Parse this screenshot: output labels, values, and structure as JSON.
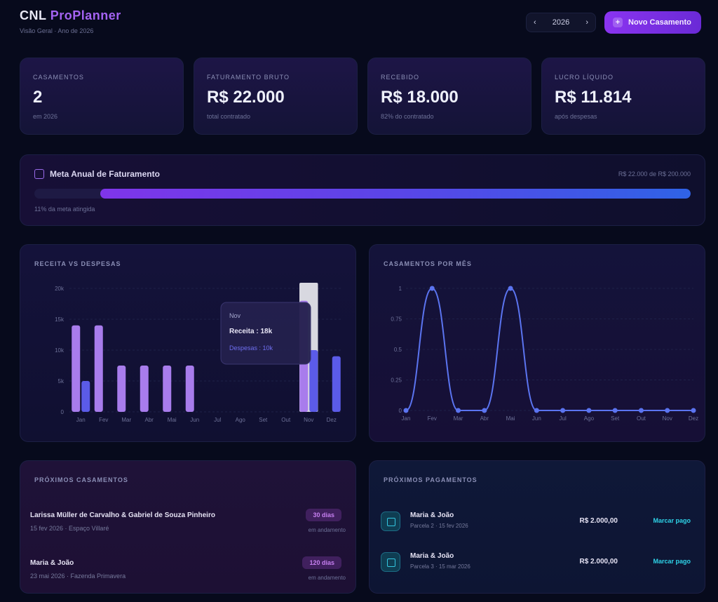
{
  "header": {
    "logo_part1": "CNL",
    "logo_part2": "ProPlanner",
    "subtitle": "Visão Geral · Ano de 2026",
    "year_value": "2026",
    "new_button_label": "Novo Casamento"
  },
  "stats": [
    {
      "label": "Casamentos",
      "value": "2",
      "sub": "em 2026"
    },
    {
      "label": "Faturamento Bruto",
      "value": "R$ 22.000",
      "sub": "total contratado"
    },
    {
      "label": "Recebido",
      "value": "R$ 18.000",
      "sub": "82% do contratado"
    },
    {
      "label": "Lucro Líquido",
      "value": "R$ 11.814",
      "sub": "após despesas"
    }
  ],
  "goal": {
    "title": "Meta Anual de Faturamento",
    "range": "R$ 22.000 de R$ 200.000",
    "note": "11% da meta atingida",
    "progress": 0.11
  },
  "revenue_chart": {
    "title": "Receita vs Despesas",
    "tooltip": {
      "month": "Nov",
      "receita_label": "Receita : 18k",
      "despesa_label": "Despesas : 10k"
    }
  },
  "weddings_chart": {
    "title": "Casamentos por Mês"
  },
  "chart_data": [
    {
      "type": "bar",
      "categories": [
        "Jan",
        "Fev",
        "Mar",
        "Abr",
        "Mai",
        "Jun",
        "Jul",
        "Ago",
        "Set",
        "Out",
        "Nov",
        "Dez"
      ],
      "series": [
        {
          "name": "Receita",
          "values": [
            14,
            14,
            7.5,
            7.5,
            7.5,
            7.5,
            0,
            0,
            0,
            0,
            18,
            0
          ]
        },
        {
          "name": "Despesas",
          "values": [
            5,
            0,
            0,
            0,
            0,
            0,
            0,
            0,
            0,
            0,
            10,
            9
          ]
        }
      ],
      "yticks": [
        "0",
        "5k",
        "10k",
        "15k",
        "20k"
      ],
      "ylim": [
        0,
        20
      ],
      "colors": {
        "Receita": "#a87cec",
        "Despesas": "#5b5be8"
      }
    },
    {
      "type": "line",
      "categories": [
        "Jan",
        "Fev",
        "Mar",
        "Abr",
        "Mai",
        "Jun",
        "Jul",
        "Ago",
        "Set",
        "Out",
        "Nov",
        "Dez"
      ],
      "series": [
        {
          "name": "Casamentos",
          "values": [
            0,
            1,
            0,
            0,
            1,
            0,
            0,
            0,
            0,
            0,
            0,
            0
          ]
        }
      ],
      "yticks": [
        "0",
        "0.25",
        "0.5",
        "0.75",
        "1"
      ],
      "ylim": [
        0,
        1
      ],
      "colors": {
        "Casamentos": "#5b74f0"
      }
    }
  ],
  "events": {
    "title": "Próximos Casamentos",
    "items": [
      {
        "title": "Larissa Müller de Carvalho & Gabriel de Souza Pinheiro",
        "meta": "15 fev 2026  ·  Espaço Villaré",
        "badge": "30 dias",
        "status": "em andamento"
      },
      {
        "title": "Maria & João",
        "meta": "23 mai 2026  ·  Fazenda Primavera",
        "badge": "120 dias",
        "status": "em andamento"
      }
    ]
  },
  "payments": {
    "title": "Próximos Pagamentos",
    "items": [
      {
        "title": "Maria & João",
        "meta": "Parcela 2  ·  15 fev 2026",
        "amount": "R$ 2.000,00",
        "action": "Marcar pago"
      },
      {
        "title": "Maria & João",
        "meta": "Parcela 3  ·  15 mar 2026",
        "amount": "R$ 2.000,00",
        "action": "Marcar pago"
      }
    ]
  }
}
